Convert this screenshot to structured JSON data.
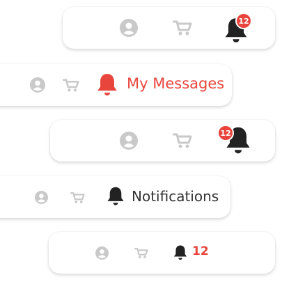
{
  "colors": {
    "accent": "#e8453c",
    "icon_muted": "#c9c9c9",
    "icon_dark": "#222222",
    "text_dark": "#333333"
  },
  "bars": [
    {
      "variant": "badge-on-bell",
      "badge_count": "12",
      "bell_color": "dark"
    },
    {
      "variant": "label",
      "label": "My Messages",
      "bell_color": "accent"
    },
    {
      "variant": "badge-left-of-bell",
      "badge_count": "12",
      "bell_color": "dark"
    },
    {
      "variant": "label",
      "label": "Notifications",
      "bell_color": "dark"
    },
    {
      "variant": "count-inline",
      "count": "12",
      "bell_color": "dark"
    }
  ],
  "icons": [
    "user-icon",
    "cart-icon",
    "bell-icon"
  ]
}
